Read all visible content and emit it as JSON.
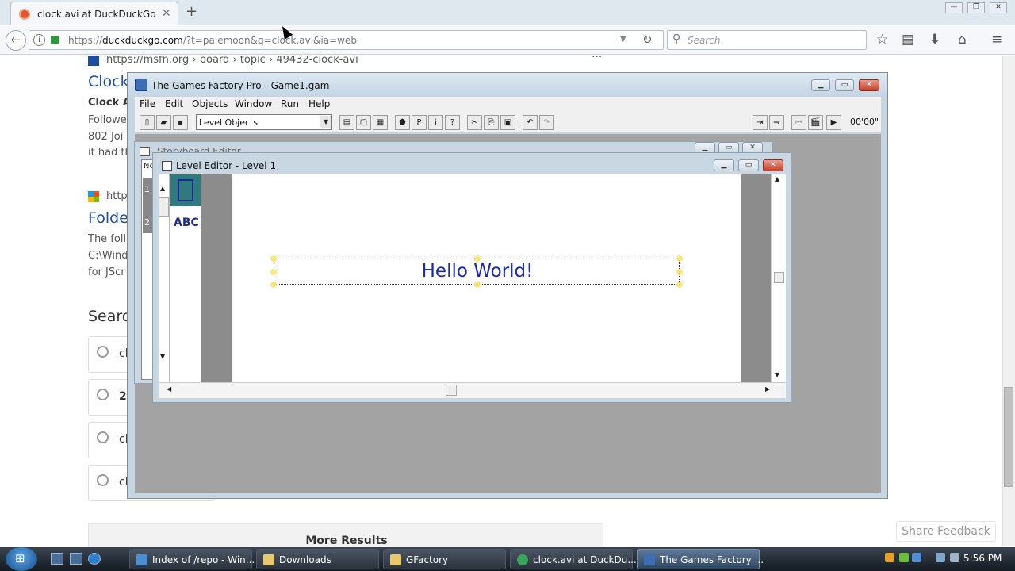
{
  "browser": {
    "tab_title": "clock.avi at DuckDuckGo",
    "tab_close": "✕",
    "new_tab": "+",
    "url_host": "duckduckgo.com",
    "url_prefix": "https://",
    "url_rest": "/?t=palemoon&q=clock.avi&ia=web",
    "search_placeholder": "Search",
    "window_controls": [
      "—",
      "❐",
      "✕"
    ]
  },
  "page": {
    "breadcrumb": "https://msfn.org › board › topic › 49432-clock-avi",
    "more_dots": "···",
    "result1": {
      "title": "Clock",
      "snip": [
        "Clock A",
        "Followe",
        "802 Joi",
        "it had th"
      ]
    },
    "result2": {
      "url": "http",
      "title": "Folde",
      "snip": [
        "The foll",
        "C:\\Wind",
        "for JScr"
      ]
    },
    "searches_heading": "Searc",
    "suggestions": [
      "cl",
      "2",
      "cl",
      "cl"
    ],
    "more_results": "More Results",
    "share_feedback": "Share Feedback"
  },
  "gf": {
    "title": "The Games Factory Pro - Game1.gam",
    "menu": [
      "File",
      "Edit",
      "Objects",
      "Window",
      "Run",
      "Help"
    ],
    "combo_value": "Level Objects",
    "timer": "00'00\""
  },
  "storyboard": {
    "title": "Storyboard Editor",
    "col_header": "Nc",
    "row_numbers": [
      "1",
      "2"
    ]
  },
  "level_editor": {
    "title": "Level Editor - Level 1",
    "palette_text": "ABC",
    "text_object": "Hello World!"
  },
  "taskbar": {
    "items": [
      {
        "label": "Index of /repo - Win...",
        "color": "#4a8fd6"
      },
      {
        "label": "Downloads",
        "color": "#e7c96b"
      },
      {
        "label": "GFactory",
        "color": "#e7c96b"
      },
      {
        "label": "clock.avi at DuckDu...",
        "color": "#3aa35a"
      },
      {
        "label": "The Games Factory ...",
        "color": "#3d6db5"
      }
    ],
    "clock": "5:56 PM"
  }
}
